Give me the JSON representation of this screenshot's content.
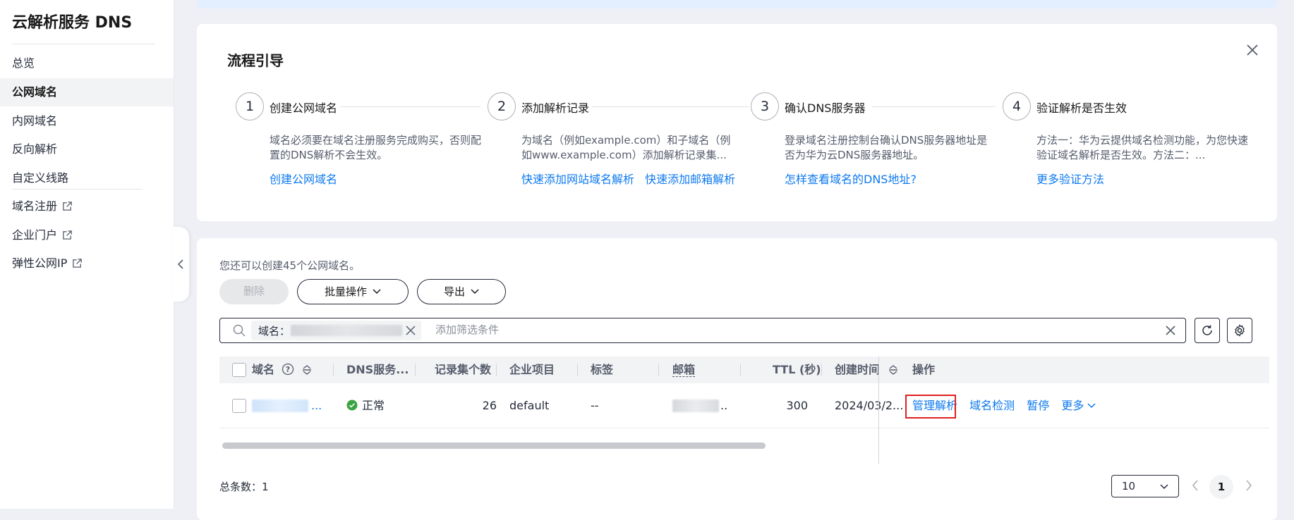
{
  "sidebar": {
    "title": "云解析服务 DNS",
    "items": [
      {
        "label": "总览"
      },
      {
        "label": "公网域名"
      },
      {
        "label": "内网域名"
      },
      {
        "label": "反向解析"
      },
      {
        "label": "自定义线路"
      },
      {
        "label": "域名注册"
      },
      {
        "label": "企业门户"
      },
      {
        "label": "弹性公网IP"
      }
    ],
    "active_item": "公网域名"
  },
  "guide": {
    "title": "流程引导",
    "steps": [
      {
        "num": "1",
        "label": "创建公网域名",
        "desc": "域名必须要在域名注册服务完成购买，否则配置的DNS解析不会生效。",
        "links": [
          "创建公网域名"
        ]
      },
      {
        "num": "2",
        "label": "添加解析记录",
        "desc": "为域名（例如example.com）和子域名（例如www.example.com）添加解析记录集...",
        "links": [
          "快速添加网站域名解析",
          "快速添加邮箱解析"
        ]
      },
      {
        "num": "3",
        "label": "确认DNS服务器",
        "desc": "登录域名注册控制台确认DNS服务器地址是否为华为云DNS服务器地址。",
        "links": [
          "怎样查看域名的DNS地址?"
        ]
      },
      {
        "num": "4",
        "label": "验证解析是否生效",
        "desc": "方法一：华为云提供域名检测功能，为您快速验证域名解析是否生效。方法二：...",
        "links": [
          "更多验证方法"
        ]
      }
    ]
  },
  "list": {
    "quota_text": "您还可以创建45个公网域名。",
    "delete_label": "删除",
    "batch_label": "批量操作",
    "export_label": "导出",
    "filter": {
      "key": "域名："
    },
    "search_placeholder": "添加筛选条件",
    "columns": [
      "域名",
      "DNS服务...",
      "记录集个数",
      "企业项目",
      "标签",
      "邮箱",
      "TTL (秒)",
      "创建时间",
      "操作"
    ],
    "rows": [
      {
        "domain_suffix": "...",
        "status": "正常",
        "record_count": "26",
        "enterprise_project": "default",
        "tag": "--",
        "email_suffix": "..",
        "ttl": "300",
        "created": "2024/03/2...",
        "actions": [
          "管理解析",
          "域名检测",
          "暂停",
          "更多"
        ]
      }
    ],
    "total_label": "总条数：",
    "total_count": "1",
    "page_size": "10",
    "current_page": "1"
  },
  "colors": {
    "link": "#0d79ef",
    "status_ok": "#3ba33f",
    "highlight_border": "#e02020"
  }
}
